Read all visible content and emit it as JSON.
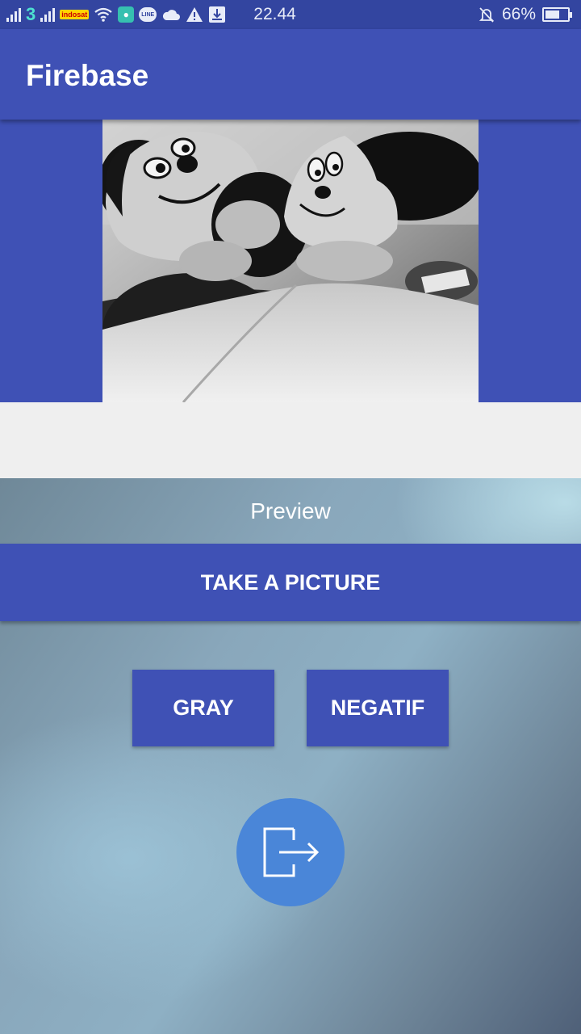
{
  "status_bar": {
    "network": "3",
    "carrier_badge": "indosat",
    "line_label": "LINE",
    "time": "22.44",
    "battery": "66%",
    "battery_level": 0.66
  },
  "app_bar": {
    "title": "Firebase"
  },
  "preview": {
    "label": "Preview"
  },
  "actions": {
    "take_picture": "TAKE A PICTURE",
    "gray": "GRAY",
    "negatif": "NEGATIF"
  },
  "icons": {
    "fab": "exit-icon"
  },
  "colors": {
    "primary": "#3f51b5",
    "status_bar": "#3345a0",
    "fab": "#4a86d8"
  }
}
